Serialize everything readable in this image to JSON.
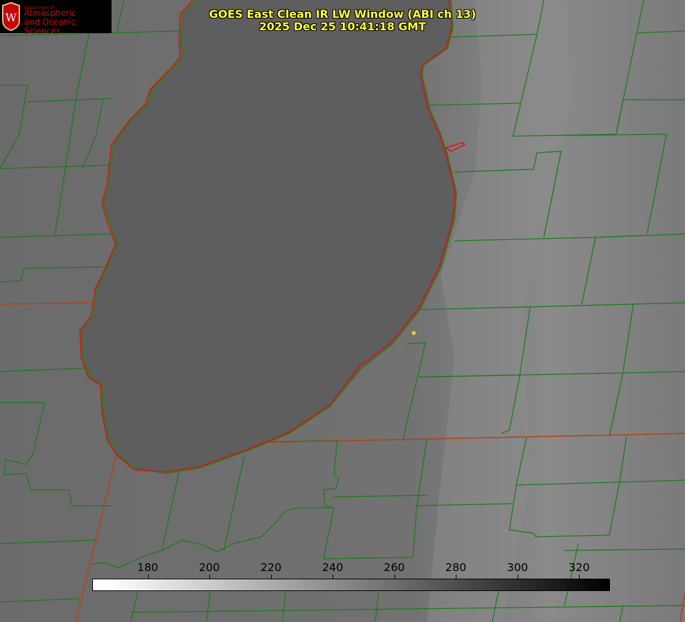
{
  "title": {
    "line1": "GOES East Clean IR LW Window (ABI ch 13)",
    "line2": "2025 Dec 25 10:41:18 GMT"
  },
  "logo": {
    "dept": "Department of",
    "line1": "Atmospheric",
    "line2": "and Oceanic Sciences",
    "seal_letter": "W"
  },
  "colorbar": {
    "ticks": [
      "180",
      "200",
      "220",
      "240",
      "260",
      "280",
      "300",
      "320"
    ],
    "range": [
      162,
      330
    ],
    "colors": {
      "low": "#ffffff",
      "high": "#000000"
    }
  },
  "colors": {
    "background": "#6a6a6a",
    "lake": "#5c5c5c",
    "boundaries": "#1e7a1e",
    "shoreline": "#e01010",
    "title": "#ffff33",
    "marker": "#e0d020"
  }
}
